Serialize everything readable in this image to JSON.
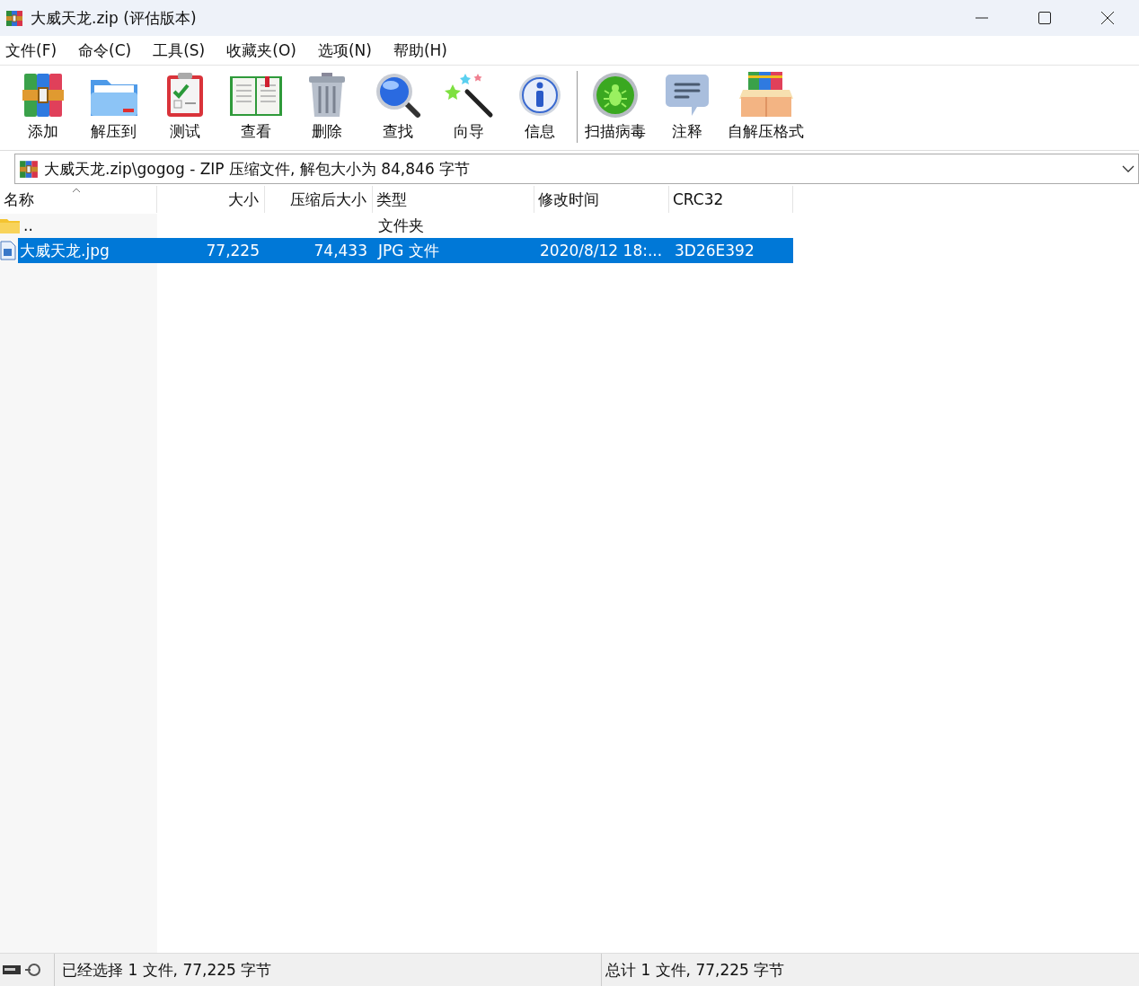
{
  "window": {
    "title": "大威天龙.zip (评估版本)"
  },
  "menu": [
    "文件(F)",
    "命令(C)",
    "工具(S)",
    "收藏夹(O)",
    "选项(N)",
    "帮助(H)"
  ],
  "toolbar": [
    {
      "label": "添加"
    },
    {
      "label": "解压到"
    },
    {
      "label": "测试"
    },
    {
      "label": "查看"
    },
    {
      "label": "删除"
    },
    {
      "label": "查找"
    },
    {
      "label": "向导"
    },
    {
      "label": "信息"
    },
    {
      "label": "扫描病毒"
    },
    {
      "label": "注释"
    },
    {
      "label": "自解压格式"
    }
  ],
  "address": {
    "value": "大威天龙.zip\\gogog - ZIP 压缩文件, 解包大小为 84,846 字节"
  },
  "table": {
    "columns": [
      {
        "label": "名称",
        "sorted": true
      },
      {
        "label": "大小",
        "sorted": false
      },
      {
        "label": "压缩后大小",
        "sorted": false
      },
      {
        "label": "类型",
        "sorted": false
      },
      {
        "label": "修改时间",
        "sorted": false
      },
      {
        "label": "CRC32",
        "sorted": false
      }
    ],
    "rows": [
      {
        "kind": "folder",
        "selected": false,
        "cells": [
          "..",
          "",
          "",
          "文件夹",
          "",
          ""
        ]
      },
      {
        "kind": "file",
        "selected": true,
        "cells": [
          "大威天龙.jpg",
          "77,225",
          "74,433",
          "JPG 文件",
          "2020/8/12 18:...",
          "3D26E392"
        ]
      }
    ]
  },
  "status_bar": {
    "left": "已经选择 1 文件, 77,225 字节",
    "right": "总计 1 文件, 77,225 字节"
  }
}
